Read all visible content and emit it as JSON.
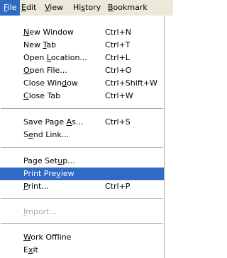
{
  "menubar": {
    "items": [
      {
        "pre": "",
        "key": "F",
        "post": "ile"
      },
      {
        "pre": "",
        "key": "E",
        "post": "dit"
      },
      {
        "pre": "",
        "key": "V",
        "post": "iew"
      },
      {
        "pre": "Hi",
        "key": "s",
        "post": "tory"
      },
      {
        "pre": "",
        "key": "B",
        "post": "ookmark"
      }
    ]
  },
  "file_menu": {
    "items": [
      {
        "pre": "",
        "key": "N",
        "post": "ew Window",
        "shortcut": "Ctrl+N"
      },
      {
        "pre": "New ",
        "key": "T",
        "post": "ab",
        "shortcut": "Ctrl+T"
      },
      {
        "pre": "Open ",
        "key": "L",
        "post": "ocation...",
        "shortcut": "Ctrl+L"
      },
      {
        "pre": "",
        "key": "O",
        "post": "pen File...",
        "shortcut": "Ctrl+O"
      },
      {
        "pre": "Close Win",
        "key": "d",
        "post": "ow",
        "shortcut": "Ctrl+Shift+W"
      },
      {
        "pre": "",
        "key": "C",
        "post": "lose Tab",
        "shortcut": "Ctrl+W"
      },
      {
        "pre": "Save Page ",
        "key": "A",
        "post": "s...",
        "shortcut": "Ctrl+S"
      },
      {
        "pre": "S",
        "key": "e",
        "post": "nd Link...",
        "shortcut": ""
      },
      {
        "pre": "Page Set",
        "key": "u",
        "post": "p...",
        "shortcut": ""
      },
      {
        "pre": "Print Pre",
        "key": "v",
        "post": "iew",
        "shortcut": ""
      },
      {
        "pre": "",
        "key": "P",
        "post": "rint...",
        "shortcut": "Ctrl+P"
      },
      {
        "pre": "",
        "key": "I",
        "post": "mport...",
        "shortcut": ""
      },
      {
        "pre": "",
        "key": "W",
        "post": "ork Offline",
        "shortcut": ""
      },
      {
        "pre": "E",
        "key": "x",
        "post": "it",
        "shortcut": ""
      }
    ]
  }
}
